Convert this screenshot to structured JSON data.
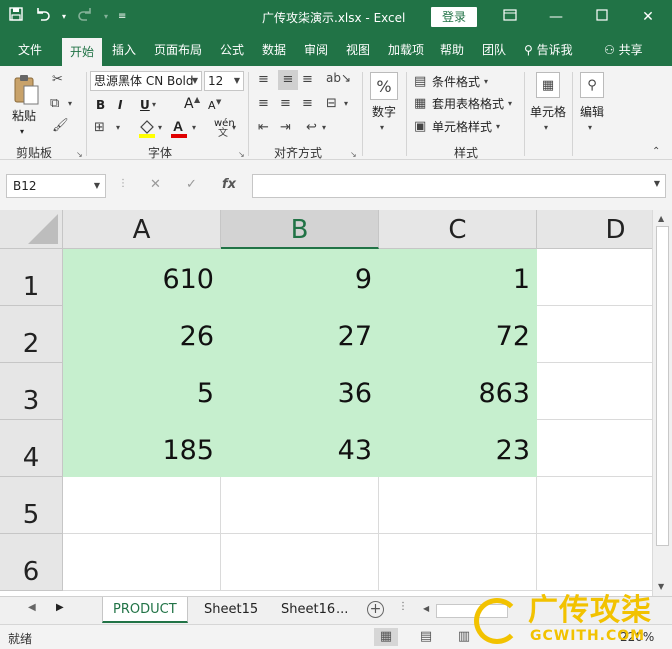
{
  "titlebar": {
    "title": "广传攻柒演示.xlsx  -  Excel",
    "login_label": "登录",
    "icons": [
      "save-icon",
      "undo-icon",
      "redo-icon",
      "customize-qat-icon",
      "ribbon-display-icon",
      "minimize-icon",
      "maximize-icon",
      "close-icon"
    ]
  },
  "ribbon_tabs": [
    "文件",
    "开始",
    "插入",
    "页面布局",
    "公式",
    "数据",
    "审阅",
    "视图",
    "加载项",
    "帮助",
    "团队",
    "告诉我",
    "共享"
  ],
  "active_tab": "开始",
  "ribbon": {
    "clipboard": {
      "paste_label": "粘贴",
      "group_label": "剪贴板"
    },
    "font": {
      "font_name": "思源黑体 CN Bold",
      "font_size": "12",
      "bold": "B",
      "italic": "I",
      "underline": "U",
      "group_label": "字体",
      "font_grow": "A",
      "font_shrink": "A",
      "phonetic": "wén"
    },
    "alignment": {
      "group_label": "对齐方式"
    },
    "number": {
      "number_label": "数字"
    },
    "styles": {
      "conditional_format": "条件格式",
      "table_format": "套用表格格式",
      "cell_style": "单元格样式",
      "group_label": "样式"
    },
    "cells": {
      "cells_label": "单元格"
    },
    "editing": {
      "editing_label": "编辑"
    }
  },
  "formula_bar": {
    "name_box": "B12",
    "fx": "fx",
    "formula_value": ""
  },
  "grid": {
    "columns": [
      "A",
      "B",
      "C",
      "D"
    ],
    "selected_column": "B",
    "rows": [
      "1",
      "2",
      "3",
      "4",
      "5",
      "6"
    ],
    "cells": [
      [
        "610",
        "9",
        "1",
        ""
      ],
      [
        "26",
        "27",
        "72",
        ""
      ],
      [
        "5",
        "36",
        "863",
        ""
      ],
      [
        "185",
        "43",
        "23",
        ""
      ],
      [
        "",
        "",
        "",
        ""
      ],
      [
        "",
        "",
        "",
        ""
      ]
    ],
    "fill_color": "#c6efce"
  },
  "sheets": {
    "tabs": [
      "PRODUCT",
      "Sheet15",
      "Sheet16"
    ],
    "active": "PRODUCT",
    "more": "..."
  },
  "status": {
    "ready": "就绪",
    "zoom": "220%"
  },
  "watermark": {
    "cn": "广传攻柒",
    "en": "GCWITH.COM"
  },
  "colors": {
    "accent": "#217346",
    "cell_fill": "#c6efce",
    "watermark": "#f2c200"
  }
}
